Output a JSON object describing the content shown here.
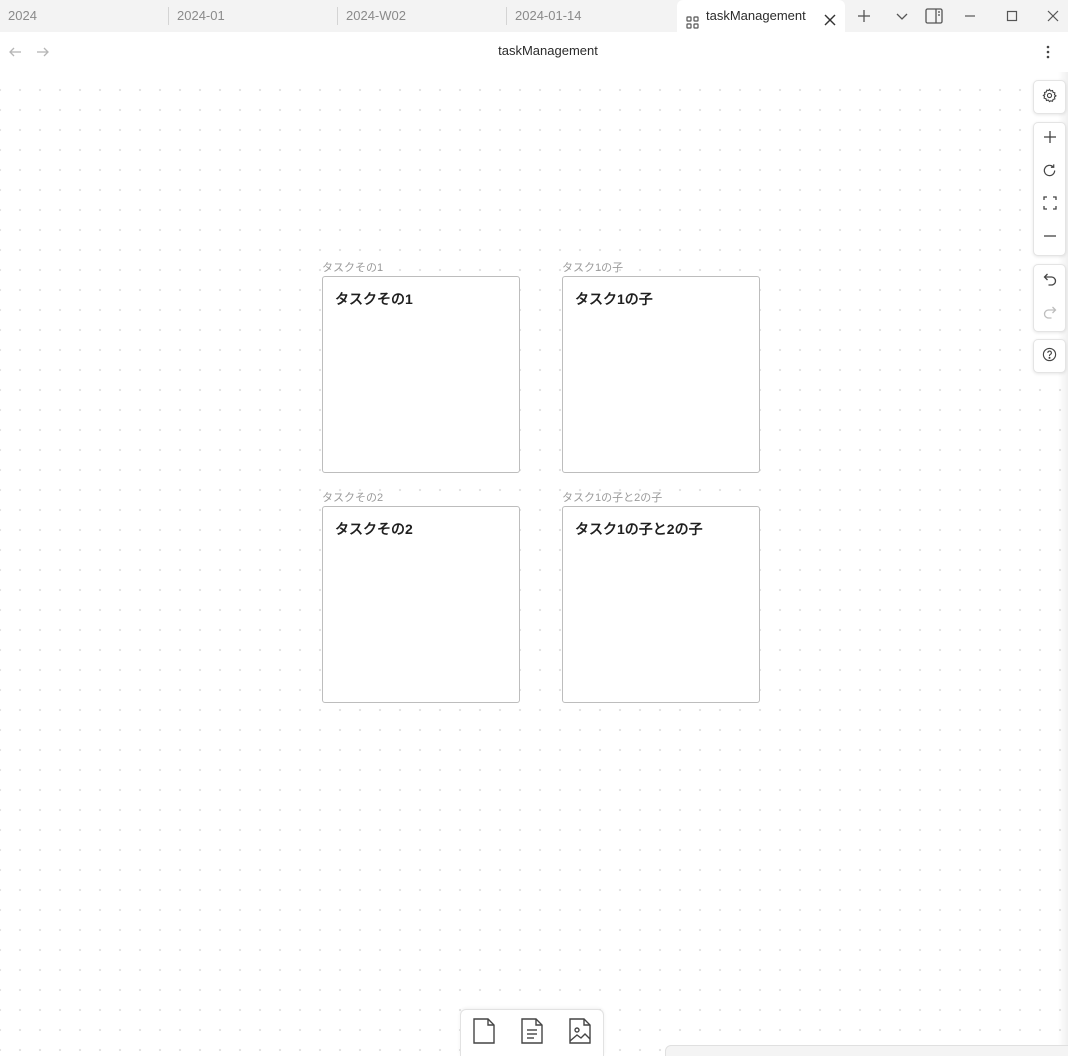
{
  "tabs": [
    {
      "label": "2024",
      "active": false
    },
    {
      "label": "2024-01",
      "active": false
    },
    {
      "label": "2024-W02",
      "active": false
    },
    {
      "label": "2024-01-14",
      "active": false
    },
    {
      "label": "taskManagement",
      "active": true,
      "icon": "canvas-icon"
    }
  ],
  "header": {
    "title": "taskManagement"
  },
  "canvas": {
    "cards": [
      {
        "label": "タスクその1",
        "title": "タスクその1"
      },
      {
        "label": "タスク1の子",
        "title": "タスク1の子"
      },
      {
        "label": "タスクその2",
        "title": "タスクその2"
      },
      {
        "label": "タスク1の子と2の子",
        "title": "タスク1の子と2の子"
      }
    ]
  },
  "right_controls": {
    "groups": [
      [
        "gear-icon"
      ],
      [
        "plus-icon",
        "reset-rotate-icon",
        "fit-screen-icon",
        "minus-icon"
      ],
      [
        "undo-icon",
        "redo-icon"
      ],
      [
        "help-icon"
      ]
    ]
  },
  "bottom_toolbar": {
    "items": [
      "new-card-icon",
      "note-file-icon",
      "media-file-icon"
    ]
  },
  "colors": {
    "tabbar_bg": "#f3f3f3",
    "card_border": "#bdbdbd",
    "label_gray": "#9a9a9a",
    "text_dark": "#1f1f1f"
  }
}
